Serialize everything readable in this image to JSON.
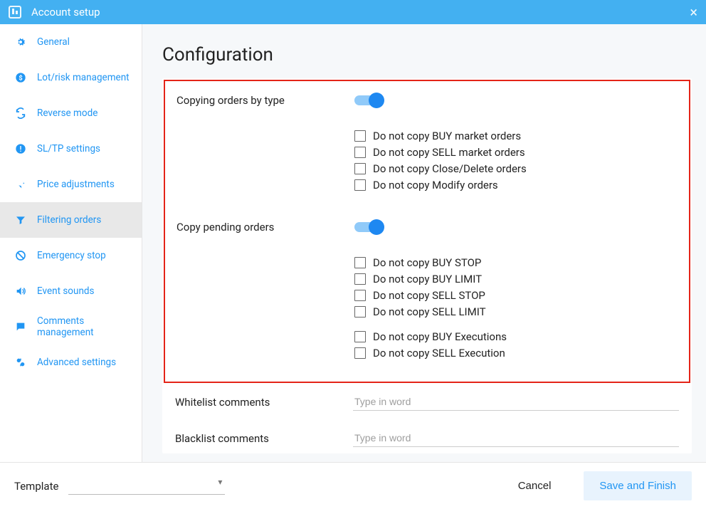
{
  "titlebar": {
    "title": "Account setup"
  },
  "sidebar": {
    "items": [
      {
        "label": "General",
        "icon": "gear-icon"
      },
      {
        "label": "Lot/risk management",
        "icon": "dollar-icon"
      },
      {
        "label": "Reverse mode",
        "icon": "reverse-icon"
      },
      {
        "label": "SL/TP settings",
        "icon": "alert-icon"
      },
      {
        "label": "Price adjustments",
        "icon": "pin-icon"
      },
      {
        "label": "Filtering orders",
        "icon": "filter-icon"
      },
      {
        "label": "Emergency stop",
        "icon": "stop-icon"
      },
      {
        "label": "Event sounds",
        "icon": "sound-icon"
      },
      {
        "label": "Comments management",
        "icon": "comment-icon"
      },
      {
        "label": "Advanced settings",
        "icon": "tools-icon"
      }
    ]
  },
  "main": {
    "heading": "Configuration",
    "section1": {
      "label": "Copying orders by type",
      "toggle_on": true,
      "checks": [
        "Do not copy BUY market orders",
        "Do not copy SELL market orders",
        "Do not copy Close/Delete orders",
        "Do not copy Modify orders"
      ]
    },
    "section2": {
      "label": "Copy pending orders",
      "toggle_on": true,
      "checks_a": [
        "Do not copy BUY STOP",
        "Do not copy BUY LIMIT",
        "Do not copy SELL STOP",
        "Do not copy SELL LIMIT"
      ],
      "checks_b": [
        "Do not copy BUY Executions",
        "Do not copy SELL Execution"
      ]
    },
    "whitelist": {
      "label": "Whitelist comments",
      "placeholder": "Type in word"
    },
    "blacklist": {
      "label": "Blacklist comments",
      "placeholder": "Type in word"
    }
  },
  "footer": {
    "template_label": "Template",
    "cancel": "Cancel",
    "save": "Save and Finish"
  }
}
